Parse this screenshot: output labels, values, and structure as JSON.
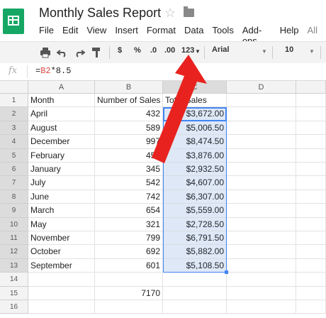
{
  "doc": {
    "title": "Monthly Sales Report"
  },
  "menu": [
    "File",
    "Edit",
    "View",
    "Insert",
    "Format",
    "Data",
    "Tools",
    "Add-ons",
    "Help",
    "All"
  ],
  "toolbar": {
    "currency": "$",
    "percent": "%",
    "dec_less": ".0",
    "dec_more": ".00",
    "more_formats": "123",
    "font": "Arial",
    "size": "10"
  },
  "formula_bar": {
    "fx": "fx",
    "eq": "=",
    "ref": "B2",
    "rest": "*8.5"
  },
  "columns": [
    "A",
    "B",
    "C",
    "D"
  ],
  "rows": [
    {
      "n": "1",
      "a": "Month",
      "b": "Number of Sales",
      "c": "Total Sales"
    },
    {
      "n": "2",
      "a": "April",
      "b": "432",
      "c": "$3,672.00"
    },
    {
      "n": "3",
      "a": "August",
      "b": "589",
      "c": "$5,006.50"
    },
    {
      "n": "4",
      "a": "December",
      "b": "997",
      "c": "$8,474.50"
    },
    {
      "n": "5",
      "a": "February",
      "b": "456",
      "c": "$3,876.00"
    },
    {
      "n": "6",
      "a": "January",
      "b": "345",
      "c": "$2,932.50"
    },
    {
      "n": "7",
      "a": "July",
      "b": "542",
      "c": "$4,607.00"
    },
    {
      "n": "8",
      "a": "June",
      "b": "742",
      "c": "$6,307.00"
    },
    {
      "n": "9",
      "a": "March",
      "b": "654",
      "c": "$5,559.00"
    },
    {
      "n": "10",
      "a": "May",
      "b": "321",
      "c": "$2,728.50"
    },
    {
      "n": "11",
      "a": "November",
      "b": "799",
      "c": "$6,791.50"
    },
    {
      "n": "12",
      "a": "October",
      "b": "692",
      "c": "$5,882.00"
    },
    {
      "n": "13",
      "a": "September",
      "b": "601",
      "c": "$5,108.50"
    },
    {
      "n": "14",
      "a": "",
      "b": "",
      "c": ""
    },
    {
      "n": "15",
      "a": "",
      "b": "7170",
      "c": ""
    },
    {
      "n": "16",
      "a": "",
      "b": "",
      "c": ""
    }
  ],
  "annotation": {
    "arrow_color": "#e8231f"
  }
}
